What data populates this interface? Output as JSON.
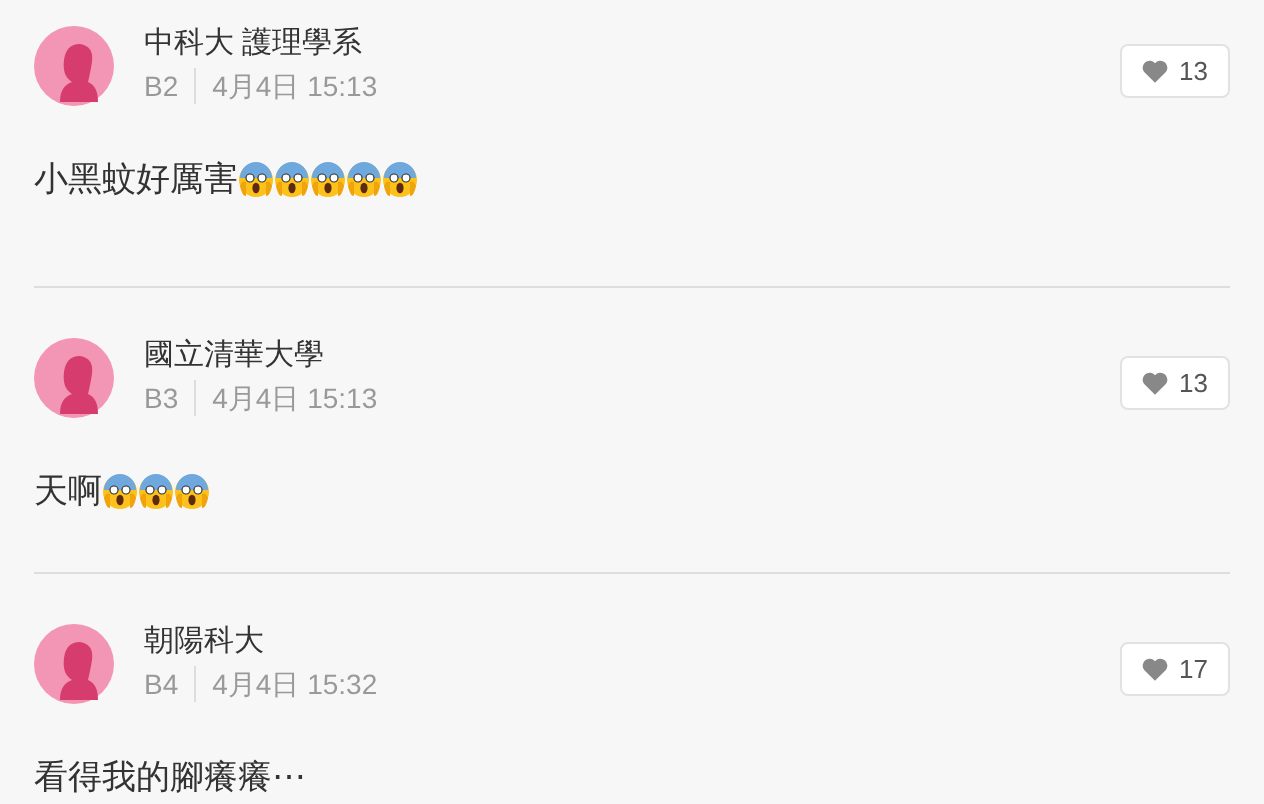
{
  "comments": [
    {
      "author": "中科大 護理學系",
      "floor": "B2",
      "time": "4月4日 15:13",
      "likes": "13",
      "text": "小黑蚊好厲害",
      "reactions": [
        {
          "kind": "scream"
        },
        {
          "kind": "scream"
        },
        {
          "kind": "scream"
        },
        {
          "kind": "scream"
        },
        {
          "kind": "scream"
        }
      ]
    },
    {
      "author": "國立清華大學",
      "floor": "B3",
      "time": "4月4日 15:13",
      "likes": "13",
      "text": "天啊",
      "reactions": [
        {
          "kind": "scream"
        },
        {
          "kind": "scream"
        },
        {
          "kind": "scream"
        }
      ]
    },
    {
      "author": "朝陽科大",
      "floor": "B4",
      "time": "4月4日 15:32",
      "likes": "17",
      "text": "看得我的腳癢癢⋯"
    }
  ]
}
